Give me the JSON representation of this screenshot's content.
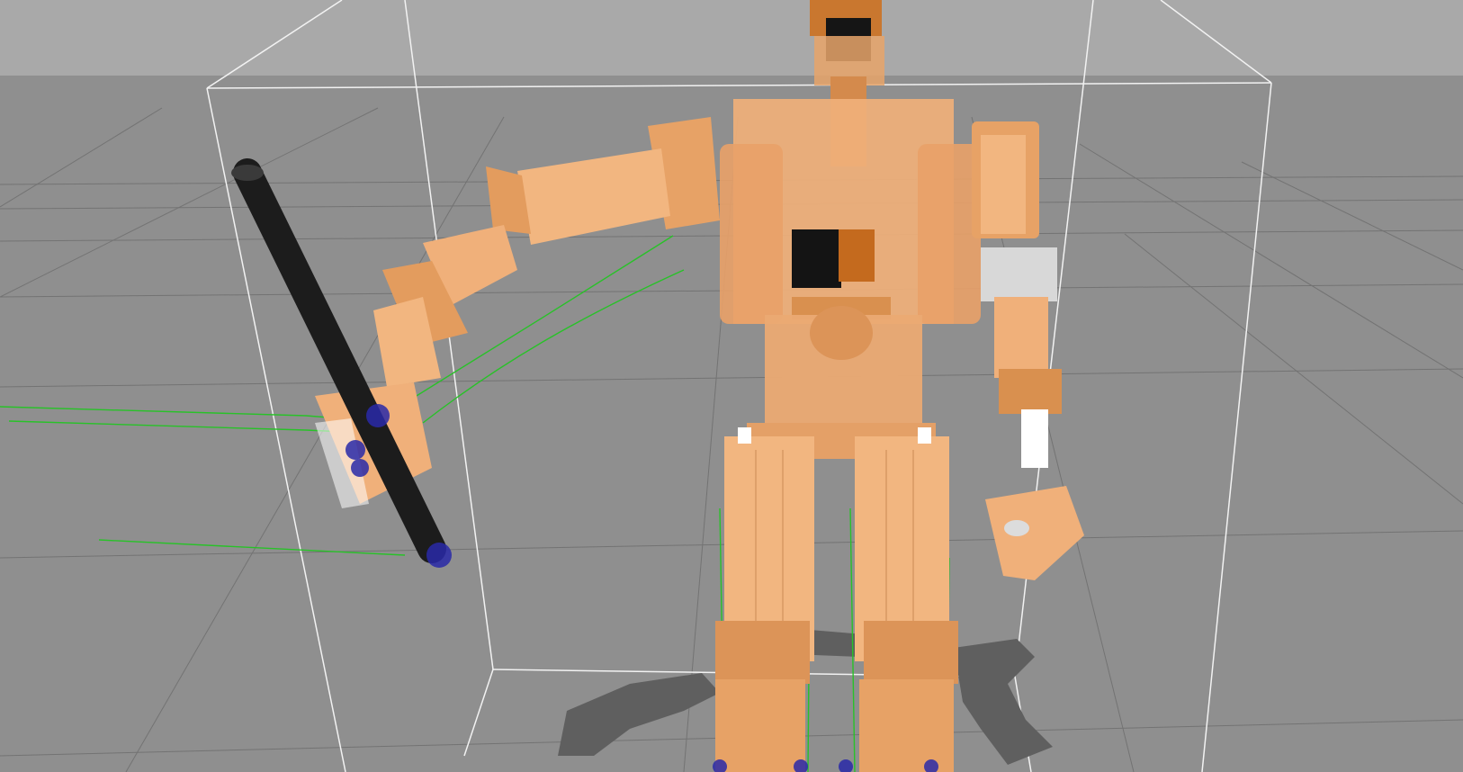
{
  "scene": {
    "kind": "3d-simulation-viewport",
    "description_free": true,
    "colors": {
      "sky": "#a8a8a8",
      "ground": "#8f8f8f",
      "grid": "#6f6f6f",
      "bounding_box": "#f2f2f2",
      "robot_body": "#f0b07a",
      "robot_shade": "#d98a4a",
      "robot_dark": "#c06a22",
      "pole": "#1d1d1d",
      "contact_marker": "#2a2aa8",
      "trace": "#27c027",
      "shadow": "#5e5e5e",
      "camera_block": "#111111"
    },
    "objects": [
      {
        "name": "robot",
        "icon": "humanoid-robot"
      },
      {
        "name": "pole",
        "icon": "cylinder-pole"
      },
      {
        "name": "bounding-box",
        "icon": "wireframe-box"
      }
    ]
  }
}
